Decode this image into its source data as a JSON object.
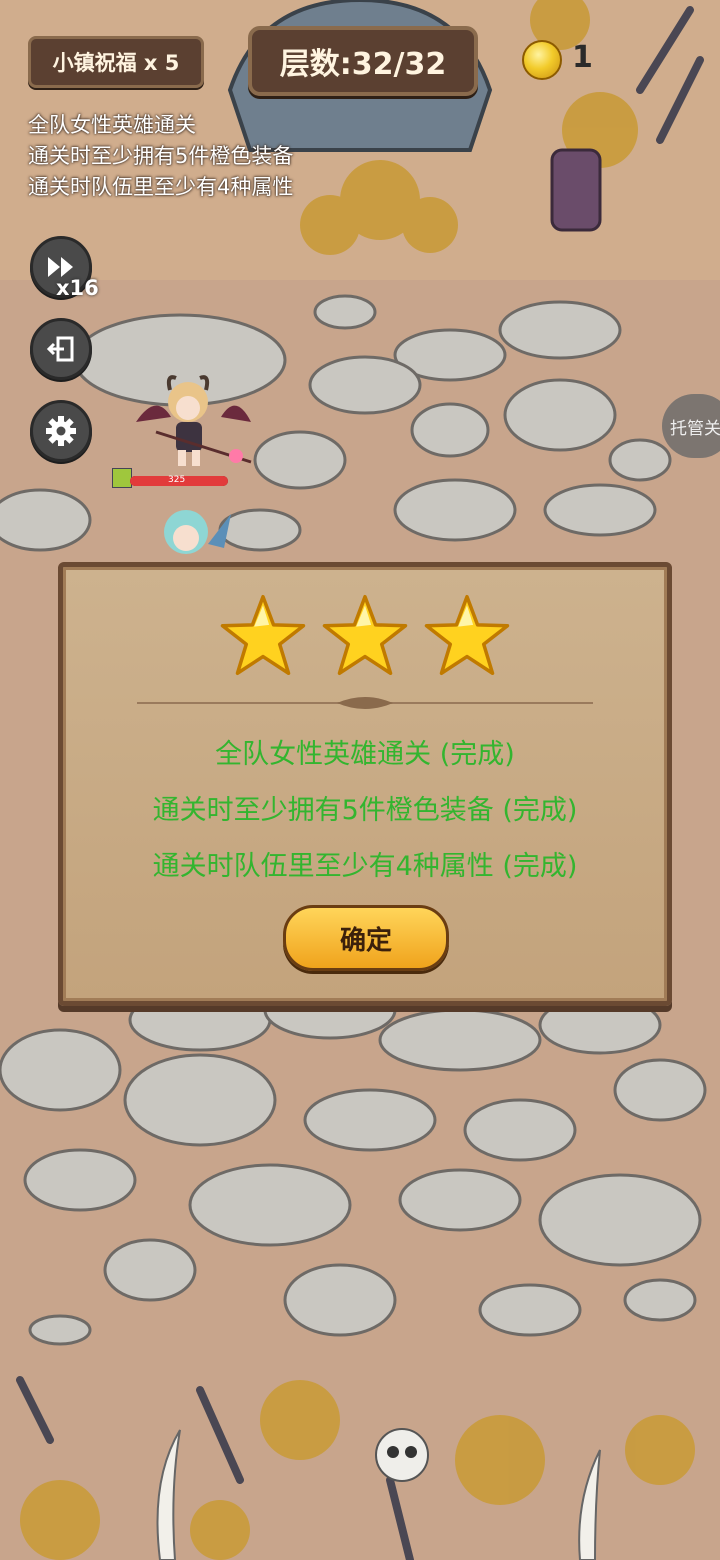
{
  "hud": {
    "blessing_label": "小镇祝福 x 5",
    "floor_label": "层数:32/32",
    "coin_count": "1",
    "speed_label": "x16",
    "auto_label": "托管关"
  },
  "quests": [
    "全队女性英雄通关",
    "通关时至少拥有5件橙色装备",
    "通关时队伍里至少有4种属性"
  ],
  "hero": {
    "hp_value": "325",
    "hp_fraction": 1.0
  },
  "result": {
    "stars_earned": 3,
    "conditions": [
      "全队女性英雄通关 (完成)",
      "通关时至少拥有5件橙色装备 (完成)",
      "通关时队伍里至少有4种属性 (完成)"
    ],
    "confirm_label": "确定"
  },
  "icons": {
    "speed": "fast-forward-icon",
    "exit": "exit-icon",
    "settings": "gear-icon",
    "coin": "coin-icon",
    "star": "star-icon"
  },
  "colors": {
    "condition_text": "#33b52f",
    "panel": "#c9ad88",
    "panel_border": "#6b4a33"
  }
}
